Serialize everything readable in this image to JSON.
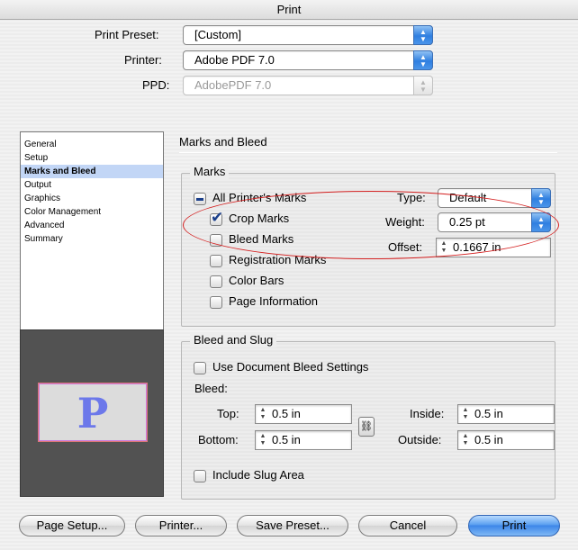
{
  "window": {
    "title": "Print"
  },
  "header": {
    "print_preset": {
      "label": "Print Preset:",
      "value": "[Custom]"
    },
    "printer": {
      "label": "Printer:",
      "value": "Adobe PDF 7.0"
    },
    "ppd": {
      "label": "PPD:",
      "value": "AdobePDF 7.0"
    }
  },
  "sidebar": {
    "items": [
      {
        "label": "General"
      },
      {
        "label": "Setup"
      },
      {
        "label": "Marks and Bleed",
        "selected": true
      },
      {
        "label": "Output"
      },
      {
        "label": "Graphics"
      },
      {
        "label": "Color Management"
      },
      {
        "label": "Advanced"
      },
      {
        "label": "Summary"
      }
    ]
  },
  "preview": {
    "letter": "P"
  },
  "panel": {
    "title": "Marks and Bleed",
    "marks": {
      "title": "Marks",
      "all_printers_marks": "All Printer's Marks",
      "crop_marks": "Crop Marks",
      "bleed_marks": "Bleed Marks",
      "registration_marks": "Registration Marks",
      "color_bars": "Color Bars",
      "page_information": "Page Information",
      "type_label": "Type:",
      "type_value": "Default",
      "weight_label": "Weight:",
      "weight_value": "0.25 pt",
      "offset_label": "Offset:",
      "offset_value": "0.1667 in"
    },
    "bleed": {
      "title": "Bleed and Slug",
      "use_document": "Use Document Bleed Settings",
      "bleed_label": "Bleed:",
      "top_label": "Top:",
      "top_value": "0.5 in",
      "bottom_label": "Bottom:",
      "bottom_value": "0.5 in",
      "inside_label": "Inside:",
      "inside_value": "0.5 in",
      "outside_label": "Outside:",
      "outside_value": "0.5 in",
      "include_slug": "Include Slug Area"
    }
  },
  "buttons": {
    "page_setup": "Page Setup...",
    "printer": "Printer...",
    "save_preset": "Save Preset...",
    "cancel": "Cancel",
    "print": "Print"
  },
  "icons": {
    "popup_arrows": "updown-arrows-icon",
    "stepper": "stepper-arrows-icon",
    "link": "chain-link-icon"
  },
  "colors": {
    "accent": "#3d86e8",
    "selection": "#c2d6f6",
    "annotation": "#d42020",
    "preview_letter": "#6c78ea"
  }
}
